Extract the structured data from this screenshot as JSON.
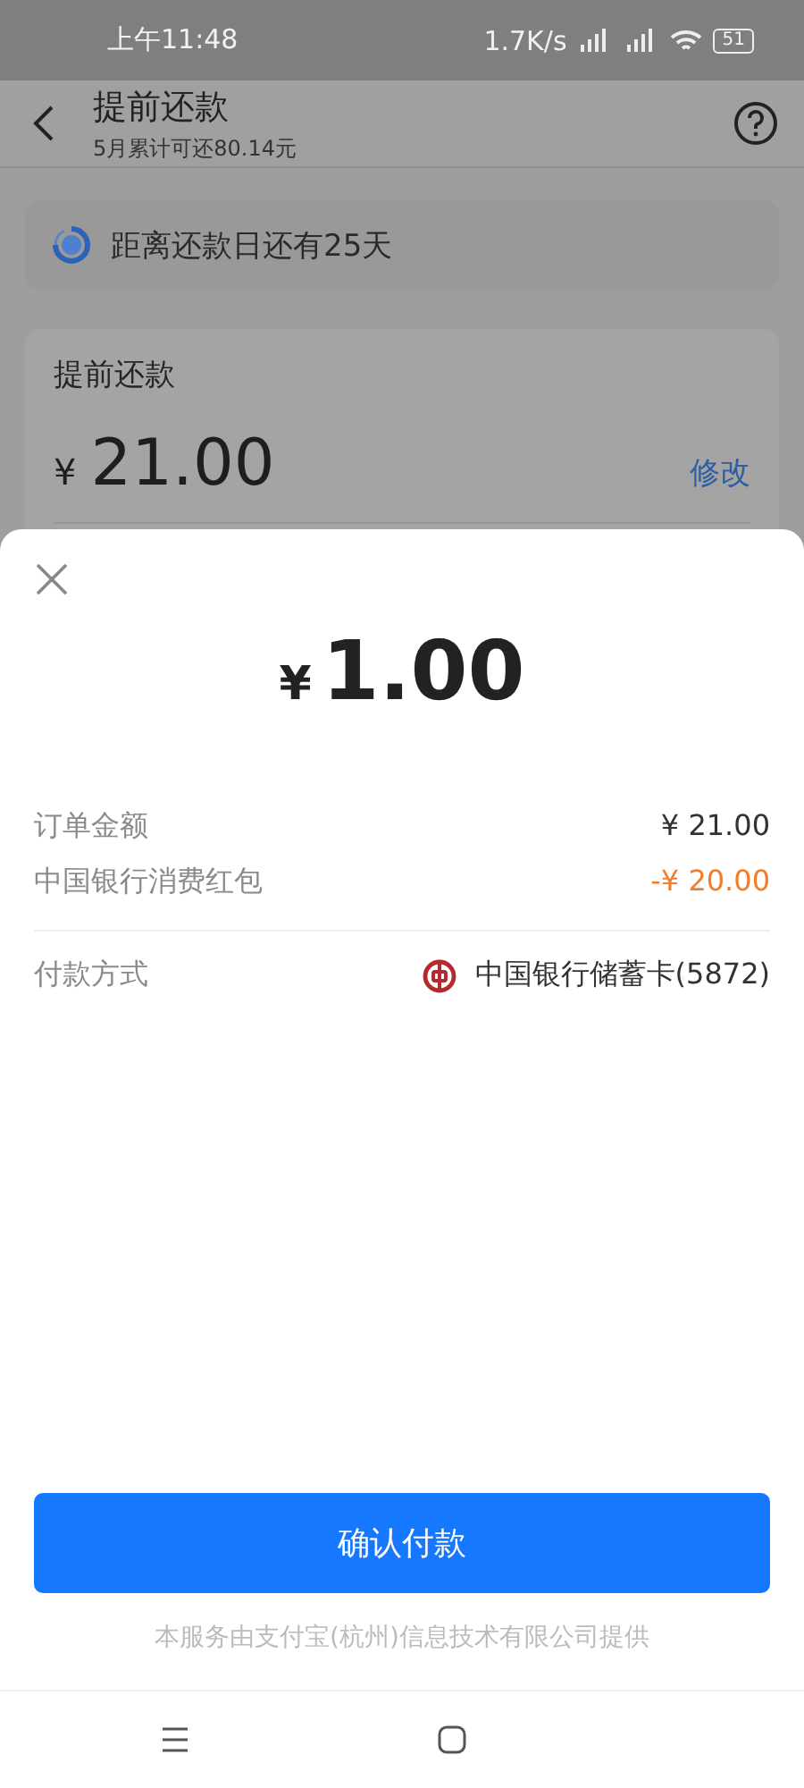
{
  "status_bar": {
    "time": "上午11:48",
    "net_speed": "1.7K/s",
    "battery": "51"
  },
  "header": {
    "title": "提前还款",
    "subtitle": "5月累计可还80.14元"
  },
  "notice": {
    "text": "距离还款日还有25天"
  },
  "repay_card": {
    "title": "提前还款",
    "currency": "¥",
    "amount": "21.00",
    "edit_link": "修改"
  },
  "payment_sheet": {
    "currency": "¥",
    "amount": "1.00",
    "rows": [
      {
        "label": "订单金额",
        "value": "¥ 21.00",
        "kind": "normal"
      },
      {
        "label": "中国银行消费红包",
        "value": "-¥ 20.00",
        "kind": "discount"
      }
    ],
    "method_label": "付款方式",
    "method": "中国银行储蓄卡(5872)",
    "confirm_button": "确认付款",
    "footer": "本服务由支付宝(杭州)信息技术有限公司提供"
  }
}
